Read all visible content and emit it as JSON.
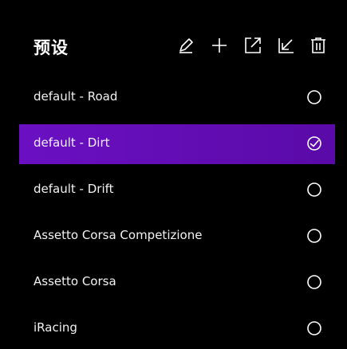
{
  "header": {
    "title": "预设",
    "tools": [
      {
        "name": "edit-icon"
      },
      {
        "name": "add-icon"
      },
      {
        "name": "export-icon"
      },
      {
        "name": "import-icon"
      },
      {
        "name": "delete-icon"
      }
    ]
  },
  "presets": [
    {
      "label": "default - Road",
      "selected": false
    },
    {
      "label": "default - Dirt",
      "selected": true
    },
    {
      "label": "default - Drift",
      "selected": false
    },
    {
      "label": "Assetto Corsa Competizione",
      "selected": false
    },
    {
      "label": "Assetto Corsa",
      "selected": false
    },
    {
      "label": "iRacing",
      "selected": false
    }
  ],
  "colors": {
    "selected_bg": "#6a10c2",
    "background": "#000000",
    "text": "#f2f2f2"
  }
}
